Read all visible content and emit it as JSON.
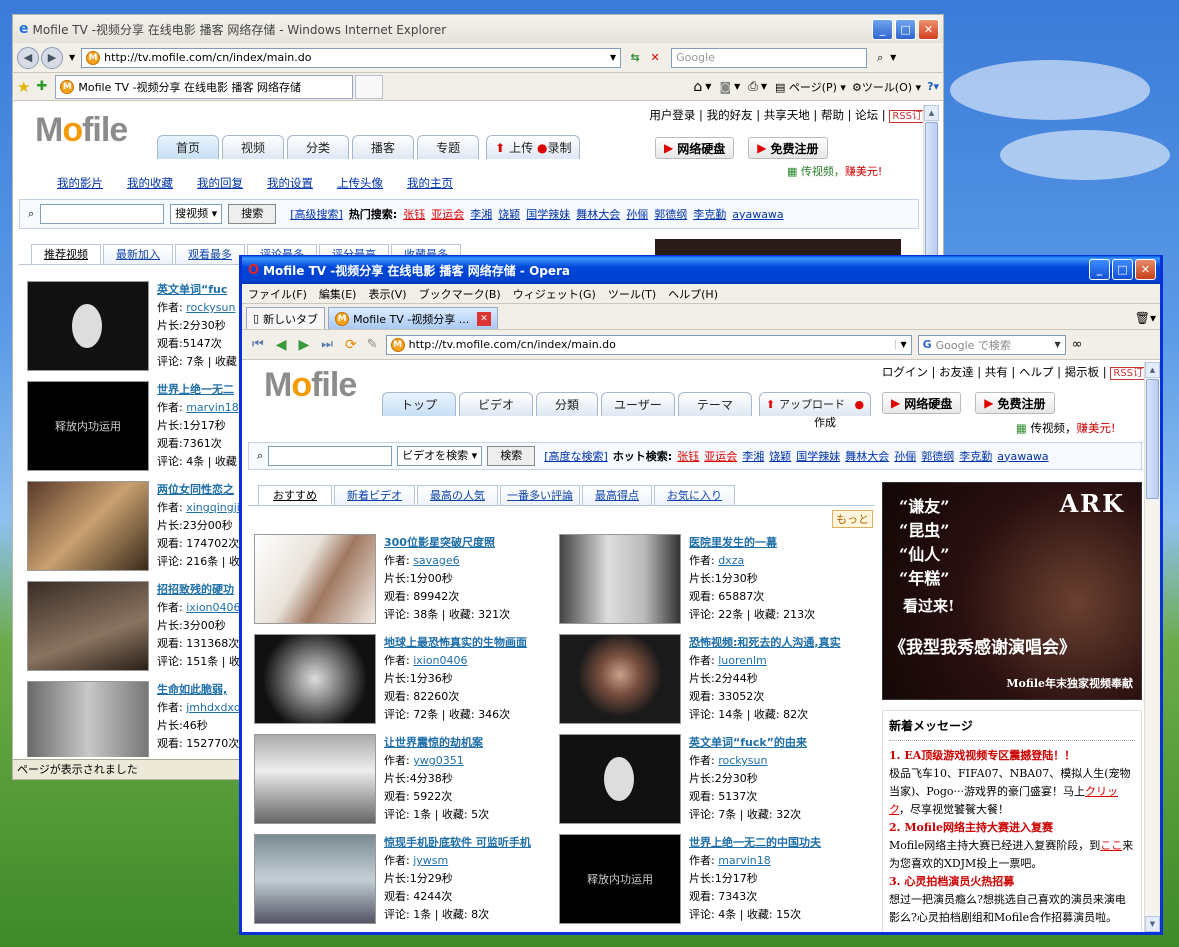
{
  "ie": {
    "title": "Mofile TV -视频分享 在线电影 播客 网络存储 - Windows Internet Explorer",
    "address": "http://tv.mofile.com/cn/index/main.do",
    "search_placeholder": "Google",
    "tab_label": "Mofile TV -视频分享 在线电影 播客 网络存储",
    "cmd": {
      "page": "ページ(P)",
      "tools": "ツール(O)"
    },
    "status": "ページが表示されました",
    "site": {
      "logo_main": "M",
      "logo_o": "o",
      "logo_rest": "file",
      "top_links": [
        "用户登录",
        "我的好友",
        "共享天地",
        "帮助",
        "论坛"
      ],
      "rss": "RSS订阅",
      "nav": [
        "首页",
        "视频",
        "分类",
        "播客",
        "专题"
      ],
      "upload": "上传",
      "record": "录制",
      "disk": "网络硬盘",
      "register": "免费注册",
      "promo_a": "传视频，",
      "promo_b": "赚美元!",
      "sublinks": [
        "我的影片",
        "我的收藏",
        "我的回复",
        "我的设置",
        "上传头像",
        "我的主页"
      ],
      "search_select": "搜视频",
      "search_btn": "搜索",
      "adv": "[高级搜索]",
      "hot_label": "热门搜索:",
      "hot": [
        "张钰",
        "亚运会"
      ],
      "hot2": [
        "李湘",
        "饶颖",
        "国学辣妹",
        "舞林大会",
        "孙俪",
        "郭德纲",
        "李克勤",
        "ayawawa"
      ],
      "tabs": [
        "推荐视频",
        "最新加入",
        "观看最多",
        "评论最多",
        "评分最高",
        "收藏最多"
      ],
      "videos": [
        {
          "title": "英文单词“fuc",
          "author": "rockysun",
          "len": "片长:2分30秒",
          "views": "观看:5147次",
          "cmt": "评论: 7条",
          "fav": "收藏"
        },
        {
          "title": "世界上绝一无二",
          "author": "marvin18",
          "len": "片长:1分17秒",
          "views": "观看:7361次",
          "cmt": "评论: 4条",
          "fav": "收藏"
        },
        {
          "title": "两位女同性恋之",
          "author": "xingqingji",
          "len": "片长:23分00秒",
          "views": "观看: 174702次",
          "cmt": "评论: 216条",
          "fav": "收"
        },
        {
          "title": "招招致残的硬功",
          "author": "ixion0406",
          "len": "片长:3分00秒",
          "views": "观看: 131368次",
          "cmt": "评论: 151条",
          "fav": "收"
        },
        {
          "title": "生命如此脆弱,",
          "author": "jmhdxdxd",
          "len": "片长:46秒",
          "views": "观看: 152770次",
          "cmt": "",
          "fav": ""
        }
      ]
    }
  },
  "opera": {
    "title": "Mofile TV -视频分享 在线电影 播客 网络存储 - Opera",
    "menu": [
      "ファイル(F)",
      "編集(E)",
      "表示(V)",
      "ブックマーク(B)",
      "ウィジェット(G)",
      "ツール(T)",
      "ヘルプ(H)"
    ],
    "new_tab": "新しいタブ",
    "tab_label": "Mofile TV -视频分享 ...",
    "address": "http://tv.mofile.com/cn/index/main.do",
    "search_placeholder": "Google で検索",
    "site": {
      "top_links": [
        "ログイン",
        "お友達",
        "共有",
        "ヘルプ",
        "掲示板"
      ],
      "rss": "RSS订阅",
      "nav": [
        "トップ",
        "ビデオ",
        "分類",
        "ユーザー",
        "テーマ"
      ],
      "upload": "アップロード",
      "record": "作成",
      "disk": "网络硬盘",
      "register": "免费注册",
      "promo_a": "传视频，",
      "promo_b": "赚美元!",
      "search_select": "ビデオを検索",
      "search_btn": "検索",
      "adv": "[高度な検索]",
      "hot_label": "ホット検索:",
      "hot": [
        "张钰",
        "亚运会"
      ],
      "hot2": [
        "李湘",
        "饶颖",
        "国学辣妹",
        "舞林大会",
        "孙俪",
        "郭德纲",
        "李克勤",
        "ayawawa"
      ],
      "tabs": [
        "おすすめ",
        "新着ビデオ",
        "最高の人気",
        "一番多い評論",
        "最高得点",
        "お気に入り"
      ],
      "more": "もっと",
      "videos": [
        {
          "title": "300位影星突破尺度照",
          "author": "savage6",
          "len": "片长:1分00秒",
          "views": "观看: 89942次",
          "meta": "评论: 38条 | 收藏: 321次"
        },
        {
          "title": "医院里发生的一幕",
          "author": "dxza",
          "len": "片长:1分30秒",
          "views": "观看: 65887次",
          "meta": "评论: 22条 | 收藏: 213次"
        },
        {
          "title": "地球上最恐怖真实的生物画面",
          "author": "ixion0406",
          "len": "片长:1分36秒",
          "views": "观看: 82260次",
          "meta": "评论: 72条 | 收藏: 346次"
        },
        {
          "title": "恐怖视频:和死去的人沟通,真实",
          "author": "luorenlm",
          "len": "片长:2分44秒",
          "views": "观看: 33052次",
          "meta": "评论: 14条 | 收藏: 82次"
        },
        {
          "title": "让世界震惊的劫机案",
          "author": "ywg0351",
          "len": "片长:4分38秒",
          "views": "观看: 5922次",
          "meta": "评论: 1条 | 收藏: 5次"
        },
        {
          "title": "英文单词“fuck”的由来",
          "author": "rockysun",
          "len": "片长:2分30秒",
          "views": "观看: 5137次",
          "meta": "评论: 7条 | 收藏: 32次"
        },
        {
          "title": "惊现手机卧底软件 可监听手机",
          "author": "jywsm",
          "len": "片长:1分29秒",
          "views": "观看: 4244次",
          "meta": "评论: 1条 | 收藏: 8次"
        },
        {
          "title": "世界上绝一无二的中国功夫",
          "author": "marvin18",
          "len": "片长:1分17秒",
          "views": "观看: 7343次",
          "meta": "评论: 4条 | 收藏: 15次"
        }
      ],
      "banner": {
        "top": "ARK",
        "q1": "“谦友”",
        "q2": "“昆虫”",
        "q3": "“仙人”",
        "q4": "“年糕”",
        "come": "看过来!",
        "big": "《我型我秀感谢演唱会》",
        "foot": "Mofile年末独家视频奉献"
      },
      "news_title": "新着メッセージ",
      "news": [
        {
          "h": "1. EA顶级游戏视频专区震撼登陆！！",
          "t": "极品飞车10、FIFA07、NBA07、模拟人生(宠物当家)、Pogo···游戏界的豪门盛宴！马上",
          "link": "クリック",
          "t2": "，尽享视觉饕餮大餐！"
        },
        {
          "h": "2. Mofile网络主持大赛进入复赛",
          "t": "Mofile网络主持大赛已经进入复赛阶段，到",
          "link": "ここ",
          "t2": "来为您喜欢的XDJM投上一票吧。"
        },
        {
          "h": "3. 心灵拍档演员火热招募",
          "t": "想过一把演员瘾么?想挑选自己喜欢的演员来演电影么?心灵拍档剧组和Mofile合作招募演员啦。",
          "link": "",
          "t2": ""
        }
      ]
    }
  },
  "colors": {
    "accent": "#f59a00",
    "link": "#0033aa",
    "hot": "#dd0000",
    "titlebar": "#0047d8"
  }
}
